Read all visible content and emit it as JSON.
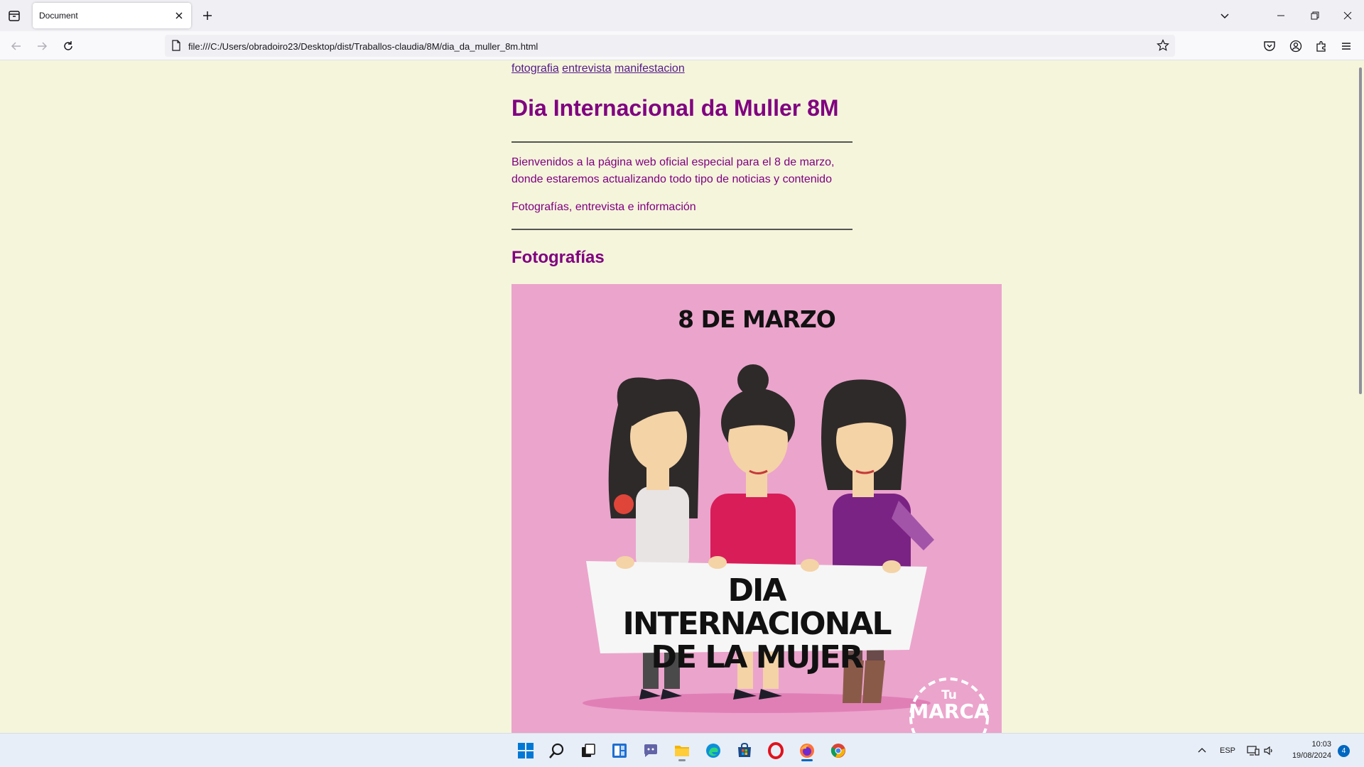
{
  "browser": {
    "tab_title": "Document",
    "url": "file:///C:/Users/obradoiro23/Desktop/dist/Traballos-claudia/8M/dia_da_muller_8m.html"
  },
  "page": {
    "nav_links": [
      "fotografia",
      "entrevista",
      "manifestacion"
    ],
    "title": "Dia Internacional da Muller 8M",
    "intro": "Bienvenidos a la página web oficial especial para el 8 de marzo, donde estaremos actualizando todo tipo de noticias y contenido",
    "subline": "Fotografías, entrevista e información",
    "section_title": "Fotografías",
    "poster": {
      "date_text": "8 DE MARZO",
      "banner_line1": "DIA INTERNACIONAL",
      "banner_line2": "DE LA MUJER",
      "brand_small": "Tu",
      "brand_big": "MARCA"
    }
  },
  "taskbar": {
    "language": "ESP",
    "time": "10:03",
    "date": "19/08/2024",
    "notification_count": "4",
    "apps": [
      "start",
      "search",
      "task-view",
      "widgets",
      "chat",
      "file-explorer",
      "edge",
      "store",
      "opera",
      "firefox",
      "chrome"
    ]
  },
  "colors": {
    "page_background": "#f5f5dc",
    "heading_color": "#800080",
    "poster_background": "#eba4cc"
  }
}
